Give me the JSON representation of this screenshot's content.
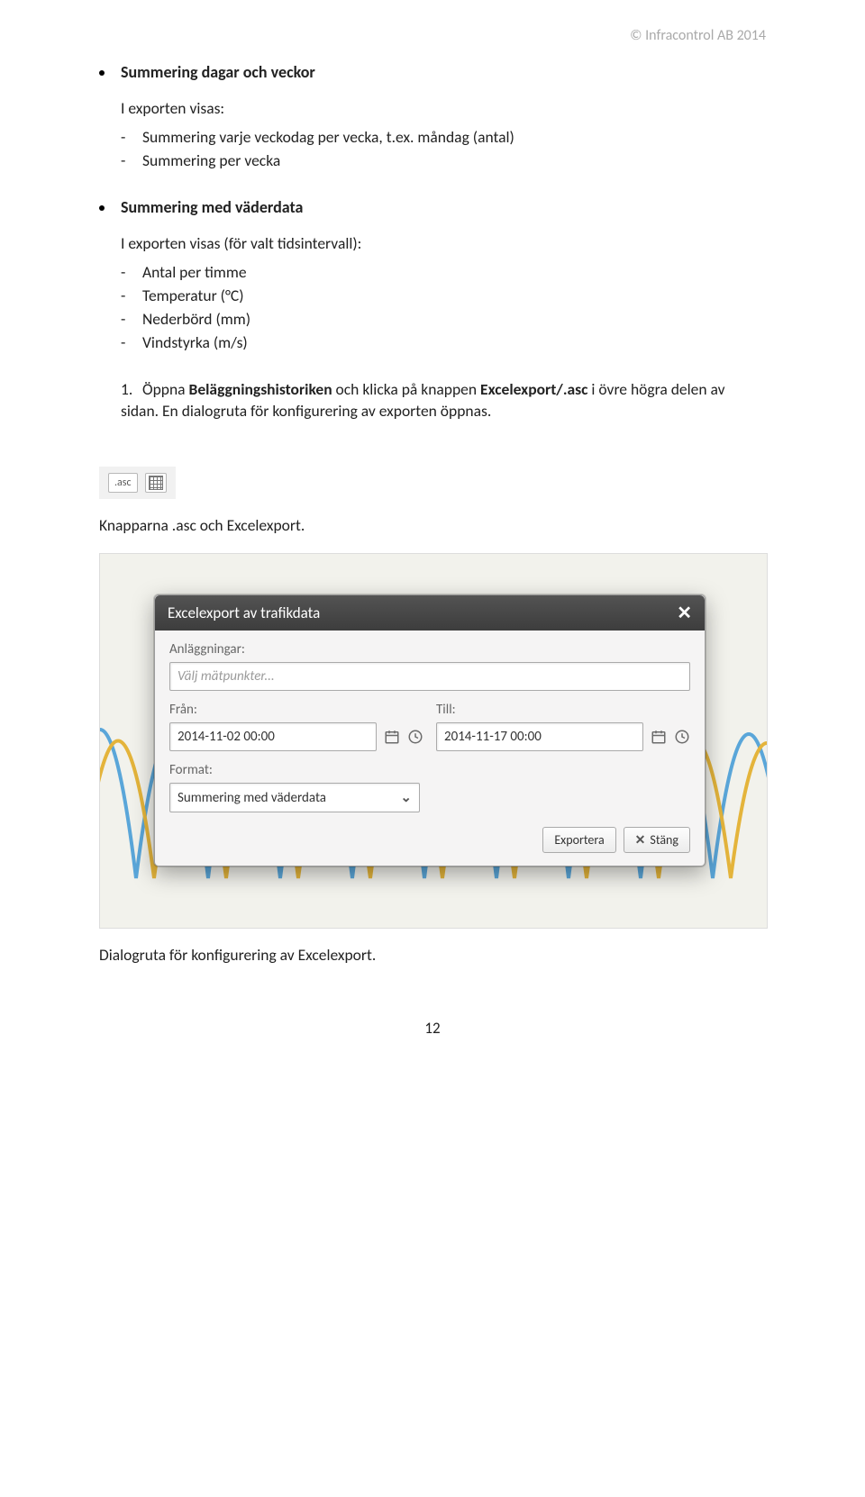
{
  "header": {
    "copyright": "© Infracontrol AB 2014"
  },
  "section1": {
    "heading": "Summering dagar och veckor",
    "intro": "I exporten visas:",
    "items": [
      "Summering varje veckodag per vecka, t.ex. måndag (antal)",
      "Summering per vecka"
    ]
  },
  "section2": {
    "heading": "Summering med väderdata",
    "intro": "I exporten visas (för valt tidsintervall):",
    "items": [
      "Antal per timme",
      "Temperatur (°C)",
      "Nederbörd (mm)",
      "Vindstyrka (m/s)"
    ]
  },
  "step": {
    "num": "1.",
    "text_a": "Öppna ",
    "bold_a": "Beläggningshistoriken",
    "text_b": " och klicka på knappen ",
    "bold_b": "Excelexport/.asc",
    "text_c": " i övre högra delen av sidan. En dialogruta för konfigurering av exporten öppnas."
  },
  "toolbar": {
    "asc_label": ".asc",
    "caption": "Knapparna .asc och Excelexport."
  },
  "dialog": {
    "title": "Excelexport av trafikdata",
    "label_anl": "Anläggningar:",
    "placeholder_anl": "Välj mätpunkter...",
    "label_from": "Från:",
    "value_from": "2014-11-02 00:00",
    "label_to": "Till:",
    "value_to": "2014-11-17 00:00",
    "label_format": "Format:",
    "value_format": "Summering med väderdata",
    "btn_export": "Exportera",
    "btn_close": "Stäng"
  },
  "caption2": "Dialogruta för konfigurering av Excelexport.",
  "pagenum": "12"
}
